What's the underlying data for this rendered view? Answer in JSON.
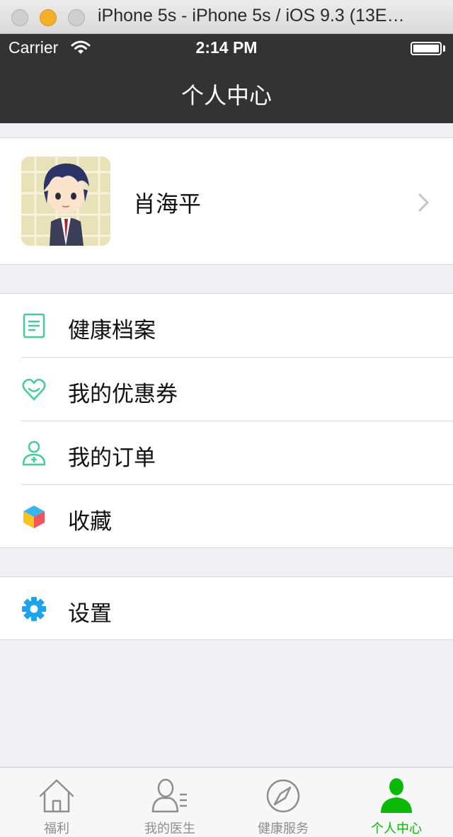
{
  "window": {
    "title": "iPhone 5s - iPhone 5s / iOS 9.3 (13E…"
  },
  "status": {
    "carrier": "Carrier",
    "time": "2:14 PM"
  },
  "nav": {
    "title": "个人中心"
  },
  "profile": {
    "name": "肖海平"
  },
  "menu": [
    {
      "label": "健康档案",
      "icon": "health-record-icon"
    },
    {
      "label": "我的优惠券",
      "icon": "heart-coupon-icon"
    },
    {
      "label": "我的订单",
      "icon": "nurse-order-icon"
    },
    {
      "label": "收藏",
      "icon": "cube-favorite-icon"
    }
  ],
  "settings": {
    "label": "设置",
    "icon": "gear-icon"
  },
  "tabs": [
    {
      "label": "福利",
      "icon": "home-icon"
    },
    {
      "label": "我的医生",
      "icon": "doctor-icon"
    },
    {
      "label": "健康服务",
      "icon": "compass-icon"
    },
    {
      "label": "个人中心",
      "icon": "person-icon",
      "active": true
    }
  ],
  "colors": {
    "accent": "#09bb07",
    "icon_teal": "#3ecf9a",
    "gear_blue": "#1aa3f0",
    "navbar": "#333333"
  }
}
